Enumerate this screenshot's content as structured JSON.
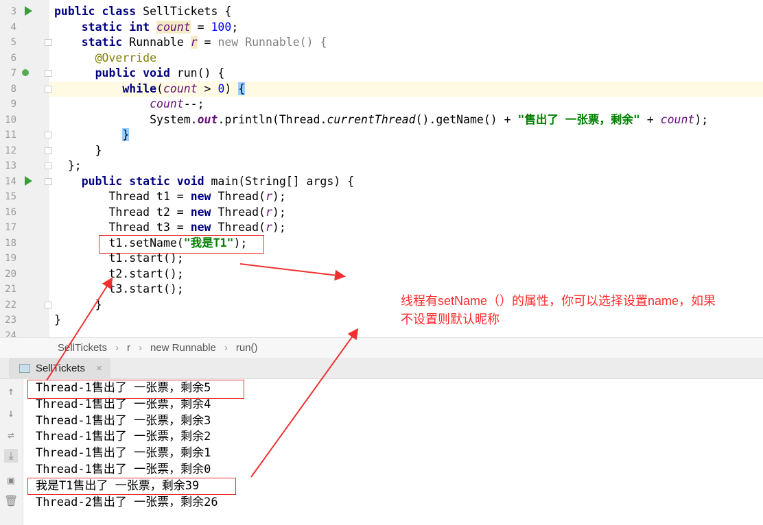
{
  "editor": {
    "lines": [
      {
        "n": "3",
        "tokens": [
          [
            "public class ",
            "kw"
          ],
          [
            "SellTickets {",
            ""
          ]
        ]
      },
      {
        "n": "4",
        "tokens": [
          [
            "    static int ",
            "kw"
          ],
          [
            "count",
            "fld hl"
          ],
          [
            " = ",
            ""
          ],
          [
            "100",
            "num"
          ],
          [
            ";",
            ""
          ]
        ]
      },
      {
        "n": "5",
        "tokens": [
          [
            "    static ",
            "kw"
          ],
          [
            "Runnable ",
            ""
          ],
          [
            "r",
            "fld hl"
          ],
          [
            " = ",
            ""
          ],
          [
            "new ",
            "gr"
          ],
          [
            "Runnable() {",
            "gr"
          ]
        ]
      },
      {
        "n": "6",
        "tokens": [
          [
            "      ",
            ""
          ],
          [
            "@Override",
            "ann"
          ]
        ]
      },
      {
        "n": "7",
        "tokens": [
          [
            "      public void ",
            "kw"
          ],
          [
            "run() {",
            ""
          ]
        ]
      },
      {
        "n": "8",
        "tokens": [
          [
            "          while",
            "kw"
          ],
          [
            "(",
            ""
          ],
          [
            "count",
            "fld"
          ],
          [
            " > ",
            ""
          ],
          [
            "0",
            "num"
          ],
          [
            ") ",
            ""
          ],
          [
            "{",
            "br"
          ]
        ]
      },
      {
        "n": "9",
        "tokens": [
          [
            "              ",
            ""
          ],
          [
            "count",
            "fld"
          ],
          [
            "--;",
            ""
          ]
        ]
      },
      {
        "n": "10",
        "tokens": [
          [
            "              System.",
            ""
          ],
          [
            "out",
            "st"
          ],
          [
            ".println(Thread.",
            ""
          ],
          [
            "currentThread",
            "itl"
          ],
          [
            "().getName() + ",
            ""
          ],
          [
            "\"售出了 一张票，剩余\"",
            "str"
          ],
          [
            " + ",
            ""
          ],
          [
            "count",
            "fld"
          ],
          [
            ");",
            ""
          ]
        ]
      },
      {
        "n": "11",
        "tokens": [
          [
            "          ",
            ""
          ],
          [
            "}",
            "br"
          ]
        ]
      },
      {
        "n": "12",
        "tokens": [
          [
            "      }",
            ""
          ]
        ]
      },
      {
        "n": "13",
        "tokens": [
          [
            "  };",
            ""
          ]
        ]
      },
      {
        "n": "14",
        "tokens": [
          [
            "    public static void ",
            "kw"
          ],
          [
            "main(String[] args) {",
            ""
          ]
        ]
      },
      {
        "n": "15",
        "tokens": [
          [
            "        Thread t1 = ",
            ""
          ],
          [
            "new ",
            "kw"
          ],
          [
            "Thread(",
            ""
          ],
          [
            "r",
            "fld"
          ],
          [
            ");",
            ""
          ]
        ]
      },
      {
        "n": "16",
        "tokens": [
          [
            "        Thread t2 = ",
            ""
          ],
          [
            "new ",
            "kw"
          ],
          [
            "Thread(",
            ""
          ],
          [
            "r",
            "fld"
          ],
          [
            ");",
            ""
          ]
        ]
      },
      {
        "n": "17",
        "tokens": [
          [
            "        Thread t3 = ",
            ""
          ],
          [
            "new ",
            "kw"
          ],
          [
            "Thread(",
            ""
          ],
          [
            "r",
            "fld"
          ],
          [
            ");",
            ""
          ]
        ]
      },
      {
        "n": "18",
        "tokens": [
          [
            "        t1.setName(",
            ""
          ],
          [
            "\"我是T1\"",
            "str"
          ],
          [
            ");",
            ""
          ]
        ]
      },
      {
        "n": "19",
        "tokens": [
          [
            "        t1.start();",
            ""
          ]
        ]
      },
      {
        "n": "20",
        "tokens": [
          [
            "        t2.start();",
            ""
          ]
        ]
      },
      {
        "n": "21",
        "tokens": [
          [
            "        t3.start();",
            ""
          ]
        ]
      },
      {
        "n": "22",
        "tokens": [
          [
            "      }",
            ""
          ]
        ]
      },
      {
        "n": "23",
        "tokens": [
          [
            "}",
            ""
          ]
        ]
      },
      {
        "n": "24",
        "tokens": []
      }
    ]
  },
  "breadcrumb": [
    "SellTickets",
    "r",
    "new Runnable",
    "run()"
  ],
  "console_tab": {
    "label": "SellTickets",
    "close": "×"
  },
  "console_toolbar": [
    "arrow-up-icon",
    "arrow-down-icon",
    "soft-wrap-icon",
    "scroll-to-end-icon",
    "print-icon",
    "trash-icon"
  ],
  "console": {
    "lines": [
      "Thread-1售出了 一张票，剩余5",
      "Thread-1售出了 一张票，剩余4",
      "Thread-1售出了 一张票，剩余3",
      "Thread-1售出了 一张票，剩余2",
      "Thread-1售出了 一张票，剩余1",
      "Thread-1售出了 一张票，剩余0",
      "我是T1售出了 一张票，剩余39",
      "Thread-2售出了 一张票，剩余26"
    ]
  },
  "annotation": {
    "line1": "线程有setName（）的属性，你可以选择设置name，如果",
    "line2": "不设置则默认昵称",
    "color": "#ff2a2a"
  }
}
